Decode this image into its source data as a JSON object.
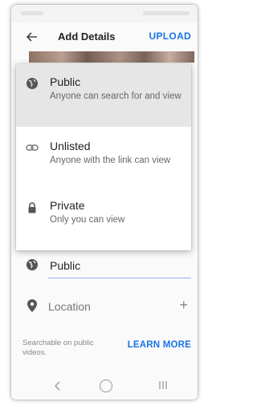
{
  "header": {
    "title": "Add Details",
    "upload_label": "UPLOAD"
  },
  "visibility_menu": {
    "items": [
      {
        "label": "Public",
        "description": "Anyone can search for and view",
        "icon": "globe-icon",
        "selected": true
      },
      {
        "label": "Unlisted",
        "description": "Anyone with the link can view",
        "icon": "link-icon",
        "selected": false
      },
      {
        "label": "Private",
        "description": "Only you can view",
        "icon": "lock-icon",
        "selected": false
      }
    ]
  },
  "form": {
    "visibility_value": "Public",
    "location_label": "Location",
    "location_add": "+",
    "info_text": "Searchable on public videos.",
    "learn_more_label": "LEARN MORE"
  },
  "colors": {
    "accent": "#1a73e8",
    "selected_bg": "#e6e6e6"
  }
}
